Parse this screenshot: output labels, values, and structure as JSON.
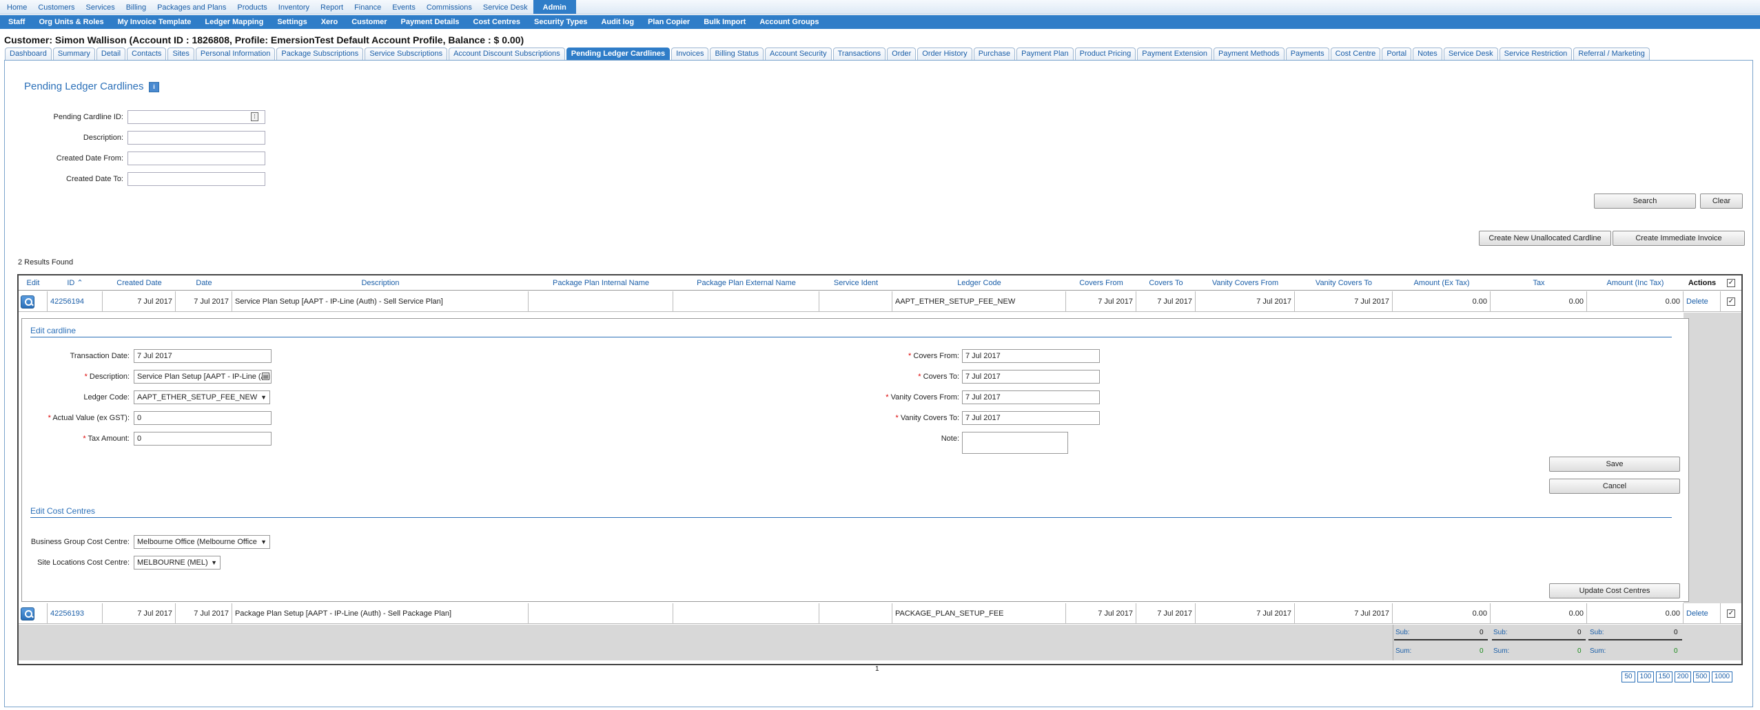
{
  "topnav": [
    {
      "label": "Home"
    },
    {
      "label": "Customers"
    },
    {
      "label": "Services"
    },
    {
      "label": "Billing"
    },
    {
      "label": "Packages and Plans"
    },
    {
      "label": "Products"
    },
    {
      "label": "Inventory"
    },
    {
      "label": "Report"
    },
    {
      "label": "Finance"
    },
    {
      "label": "Events"
    },
    {
      "label": "Commissions"
    },
    {
      "label": "Service Desk"
    },
    {
      "label": "Admin"
    }
  ],
  "subnav": [
    {
      "label": "Staff"
    },
    {
      "label": "Org Units & Roles"
    },
    {
      "label": "My Invoice Template"
    },
    {
      "label": "Ledger Mapping"
    },
    {
      "label": "Settings"
    },
    {
      "label": "Xero"
    },
    {
      "label": "Customer"
    },
    {
      "label": "Payment Details"
    },
    {
      "label": "Cost Centres"
    },
    {
      "label": "Security Types"
    },
    {
      "label": "Audit log"
    },
    {
      "label": "Plan Copier"
    },
    {
      "label": "Bulk Import"
    },
    {
      "label": "Account Groups"
    }
  ],
  "customer_header": "Customer: Simon Wallison (Account ID : 1826808, Profile: EmersionTest Default Account Profile, Balance : $ 0.00)",
  "tabs": [
    "Dashboard",
    "Summary",
    "Detail",
    "Contacts",
    "Sites",
    "Personal Information",
    "Package Subscriptions",
    "Service Subscriptions",
    "Account Discount Subscriptions",
    "Pending Ledger Cardlines",
    "Invoices",
    "Billing Status",
    "Account Security",
    "Transactions",
    "Order",
    "Order History",
    "Purchase",
    "Payment Plan",
    "Product Pricing",
    "Payment Extension",
    "Payment Methods",
    "Payments",
    "Cost Centre",
    "Portal",
    "Notes",
    "Service Desk",
    "Service Restriction",
    "Referral / Marketing"
  ],
  "page_title": "Pending Ledger Cardlines",
  "search": {
    "cardline_id_label": "Pending Cardline ID:",
    "description_label": "Description:",
    "created_from_label": "Created Date From:",
    "created_to_label": "Created Date To:",
    "search_button": "Search",
    "clear_button": "Clear"
  },
  "actions": {
    "create_unallocated": "Create New Unallocated Cardline",
    "create_invoice": "Create Immediate Invoice"
  },
  "results_count": "2 Results Found",
  "columns": [
    "Edit",
    "ID ⌃",
    "Created Date",
    "Date",
    "Description",
    "Package Plan Internal Name",
    "Package Plan External Name",
    "Service Ident",
    "Ledger Code",
    "Covers From",
    "Covers To",
    "Vanity Covers From",
    "Vanity Covers To",
    "Amount (Ex Tax)",
    "Tax",
    "Amount (Inc Tax)",
    "Actions"
  ],
  "rows": [
    {
      "id": "42256194",
      "created": "7 Jul 2017",
      "date": "7 Jul 2017",
      "description": "Service Plan Setup [AAPT - IP-Line (Auth) - Sell Service Plan]",
      "internal": "",
      "external": "",
      "ident": "",
      "ledger": "AAPT_ETHER_SETUP_FEE_NEW",
      "covers_from": "7 Jul 2017",
      "covers_to": "7 Jul 2017",
      "vanity_from": "7 Jul 2017",
      "vanity_to": "7 Jul 2017",
      "amount_ex": "0.00",
      "tax": "0.00",
      "amount_inc": "0.00",
      "action": "Delete"
    },
    {
      "id": "42256193",
      "created": "7 Jul 2017",
      "date": "7 Jul 2017",
      "description": "Package Plan Setup [AAPT - IP-Line (Auth) - Sell Package Plan]",
      "internal": "",
      "external": "",
      "ident": "",
      "ledger": "PACKAGE_PLAN_SETUP_FEE",
      "covers_from": "7 Jul 2017",
      "covers_to": "7 Jul 2017",
      "vanity_from": "7 Jul 2017",
      "vanity_to": "7 Jul 2017",
      "amount_ex": "0.00",
      "tax": "0.00",
      "amount_inc": "0.00",
      "action": "Delete"
    }
  ],
  "edit": {
    "title": "Edit cardline",
    "transaction_date_label": "Transaction Date:",
    "transaction_date": "7 Jul 2017",
    "description_label": "Description:",
    "description": "Service Plan Setup [AAPT - IP-Line (Au",
    "ledger_code_label": "Ledger Code:",
    "ledger_code": "AAPT_ETHER_SETUP_FEE_NEW",
    "actual_value_label": "Actual Value (ex GST):",
    "actual_value": "0",
    "tax_amount_label": "Tax Amount:",
    "tax_amount": "0",
    "covers_from_label": "Covers From:",
    "covers_from": "7 Jul 2017",
    "covers_to_label": "Covers To:",
    "covers_to": "7 Jul 2017",
    "vanity_from_label": "Vanity Covers From:",
    "vanity_from": "7 Jul 2017",
    "vanity_to_label": "Vanity Covers To:",
    "vanity_to": "7 Jul 2017",
    "note_label": "Note:",
    "save_button": "Save",
    "cancel_button": "Cancel",
    "cost_title": "Edit Cost Centres",
    "business_label": "Business Group Cost Centre:",
    "business_value": "Melbourne Office (Melbourne Office",
    "site_label": "Site Locations Cost Centre:",
    "site_value": "MELBOURNE (MEL)",
    "update_button": "Update Cost Centres"
  },
  "totals": {
    "sub_label": "Sub:",
    "sum_label": "Sum:",
    "ex_sub": "0",
    "tax_sub": "0",
    "inc_sub": "0",
    "ex_sum": "0",
    "tax_sum": "0",
    "inc_sum": "0"
  },
  "pagination": {
    "current_page": "1",
    "sizes": [
      "50",
      "100",
      "150",
      "200",
      "500",
      "1000"
    ]
  },
  "required_marker": "*"
}
